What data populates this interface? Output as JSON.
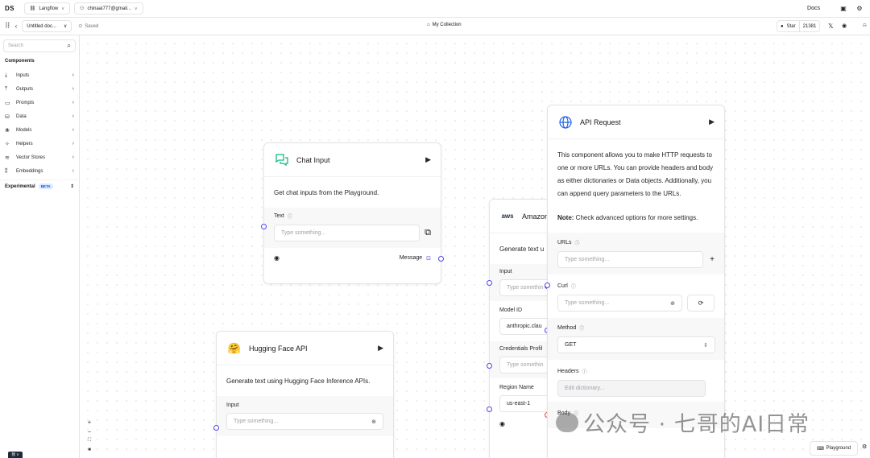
{
  "topbar": {
    "logo": "DS",
    "workspace": "Langflow",
    "account": "chinaai777@gmail...",
    "docs": "Docs"
  },
  "subbar": {
    "flow_name": "Untitled doc...",
    "saved": "Saved",
    "collection": "My Collection",
    "star_label": "Star",
    "star_count": "21381"
  },
  "sidebar": {
    "search_placeholder": "Search",
    "components_header": "Components",
    "items": [
      {
        "label": "Inputs",
        "icon": "download-icon"
      },
      {
        "label": "Outputs",
        "icon": "upload-icon"
      },
      {
        "label": "Prompts",
        "icon": "terminal-icon"
      },
      {
        "label": "Data",
        "icon": "database-icon"
      },
      {
        "label": "Models",
        "icon": "brain-icon"
      },
      {
        "label": "Helpers",
        "icon": "wand-icon"
      },
      {
        "label": "Vector Stores",
        "icon": "layers-icon"
      },
      {
        "label": "Embeddings",
        "icon": "binary-icon"
      }
    ],
    "experimental": "Experimental",
    "beta": "BETA",
    "user_chip": "我 ∨"
  },
  "nodes": {
    "chat_input": {
      "title": "Chat Input",
      "description": "Get chat inputs from the Playground.",
      "text_label": "Text",
      "text_placeholder": "Type something...",
      "output_label": "Message"
    },
    "hf": {
      "title": "Hugging Face API",
      "description": "Generate text using Hugging Face Inference APIs.",
      "input_label": "Input",
      "input_placeholder": "Type something..."
    },
    "amazon": {
      "title": "Amazon",
      "description": "Generate text u",
      "input_label": "Input",
      "input_placeholder": "Type somethin",
      "model_label": "Model ID",
      "model_value": "anthropic.clau",
      "cred_label": "Credentials Profil",
      "cred_placeholder": "Type somethin",
      "region_label": "Region Name",
      "region_value": "us-east-1"
    },
    "api": {
      "title": "API Request",
      "description": "This component allows you to make HTTP requests to one or more URLs. You can provide headers and body as either dictionaries or Data objects. Additionally, you can append query parameters to the URLs.",
      "note_bold": "Note:",
      "note_text": " Check advanced options for more settings.",
      "urls_label": "URLs",
      "urls_placeholder": "Type something...",
      "curl_label": "Curl",
      "curl_placeholder": "Type something...",
      "method_label": "Method",
      "method_value": "GET",
      "headers_label": "Headers",
      "headers_placeholder": "Edit dictionary...",
      "body_label": "Body"
    }
  },
  "watermark": "公众号 · 七哥的AI日常",
  "playground": "Playground",
  "colors": {
    "accent": "#4f46e5",
    "port_red": "#ef4444",
    "chat_icon": "#10b981",
    "api_icon": "#2563eb"
  }
}
